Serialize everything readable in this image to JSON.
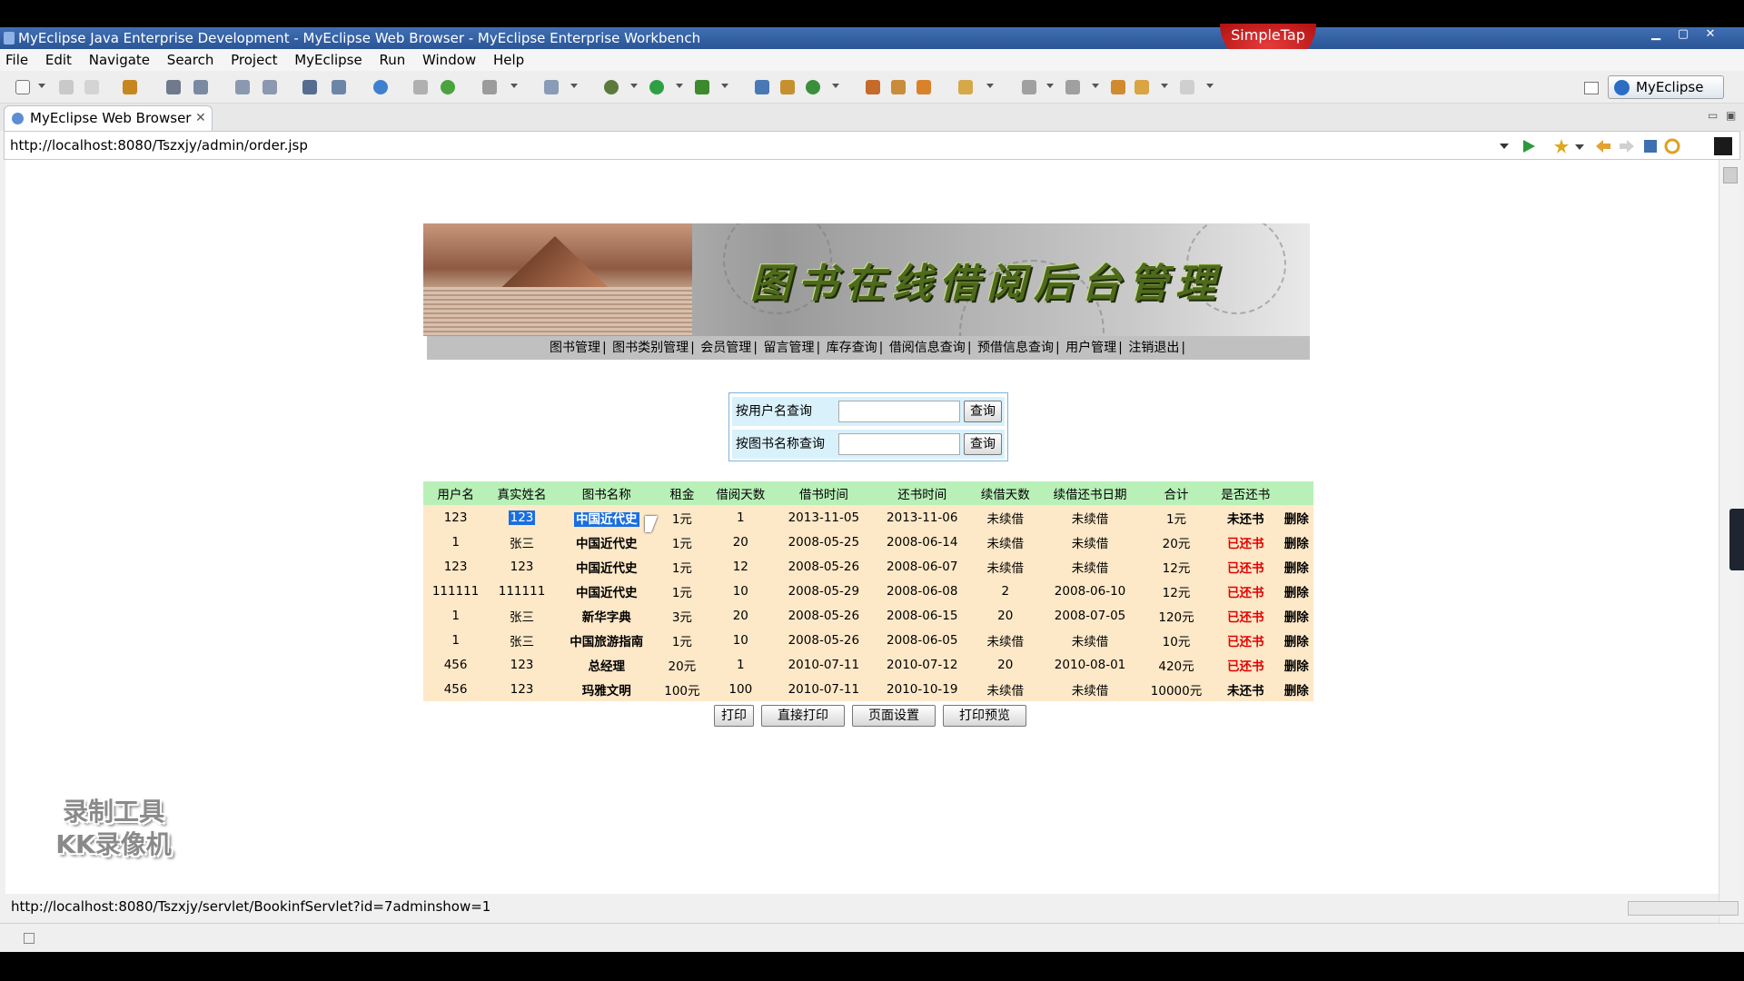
{
  "window": {
    "title": "MyEclipse Java Enterprise Development - MyEclipse Web Browser - MyEclipse Enterprise Workbench",
    "overlay_badge": "SimpleTap"
  },
  "menu": [
    "File",
    "Edit",
    "Navigate",
    "Search",
    "Project",
    "MyEclipse",
    "Run",
    "Window",
    "Help"
  ],
  "perspective": {
    "label": "MyEclipse J..."
  },
  "editor_tab": {
    "label": "MyEclipse Web Browser",
    "close": "✕"
  },
  "browser": {
    "url": "http://localhost:8080/Tszxjy/admin/order.jsp"
  },
  "page": {
    "banner_title": "图书在线借阅后台管理",
    "nav": [
      "图书管理",
      "图书类别管理",
      "会员管理",
      "留言管理",
      "库存查询",
      "借阅信息查询",
      "预借信息查询",
      "用户管理",
      "注销退出"
    ],
    "search": {
      "by_user_label": "按用户名查询",
      "by_book_label": "按图书名称查询",
      "button_label": "查询",
      "by_user_value": "",
      "by_book_value": ""
    },
    "table": {
      "headers": [
        "用户名",
        "真实姓名",
        "图书名称",
        "租金",
        "借阅天数",
        "借书时间",
        "还书时间",
        "续借天数",
        "续借还书日期",
        "合计",
        "是否还书",
        ""
      ],
      "rows": [
        [
          "123",
          "123",
          "中国近代史",
          "1元",
          "1",
          "2013-11-05",
          "2013-11-06",
          "未续借",
          "未续借",
          "1元",
          "未还书",
          "删除"
        ],
        [
          "1",
          "张三",
          "中国近代史",
          "1元",
          "20",
          "2008-05-25",
          "2008-06-14",
          "未续借",
          "未续借",
          "20元",
          "已还书",
          "删除"
        ],
        [
          "123",
          "123",
          "中国近代史",
          "1元",
          "12",
          "2008-05-26",
          "2008-06-07",
          "未续借",
          "未续借",
          "12元",
          "已还书",
          "删除"
        ],
        [
          "111111",
          "111111",
          "中国近代史",
          "1元",
          "10",
          "2008-05-29",
          "2008-06-08",
          "2",
          "2008-06-10",
          "12元",
          "已还书",
          "删除"
        ],
        [
          "1",
          "张三",
          "新华字典",
          "3元",
          "20",
          "2008-05-26",
          "2008-06-15",
          "20",
          "2008-07-05",
          "120元",
          "已还书",
          "删除"
        ],
        [
          "1",
          "张三",
          "中国旅游指南",
          "1元",
          "10",
          "2008-05-26",
          "2008-06-05",
          "未续借",
          "未续借",
          "10元",
          "已还书",
          "删除"
        ],
        [
          "456",
          "123",
          "总经理",
          "20元",
          "1",
          "2010-07-11",
          "2010-07-12",
          "20",
          "2010-08-01",
          "420元",
          "已还书",
          "删除"
        ],
        [
          "456",
          "123",
          "玛雅文明",
          "100元",
          "100",
          "2010-07-11",
          "2010-10-19",
          "未续借",
          "未续借",
          "10000元",
          "未还书",
          "删除"
        ]
      ]
    },
    "actions": [
      "打印",
      "直接打印",
      "页面设置",
      "打印预览"
    ]
  },
  "status_url": "http://localhost:8080/Tszxjy/servlet/BookinfServlet?id=7adminshow=1",
  "watermark": [
    "录制工具",
    "KK录像机"
  ],
  "colors": {
    "returned_text": "#e00000",
    "table_header_bg": "#b8f0b8",
    "table_row_bg": "#fde8c8",
    "selection_bg": "#1a6fe0"
  }
}
